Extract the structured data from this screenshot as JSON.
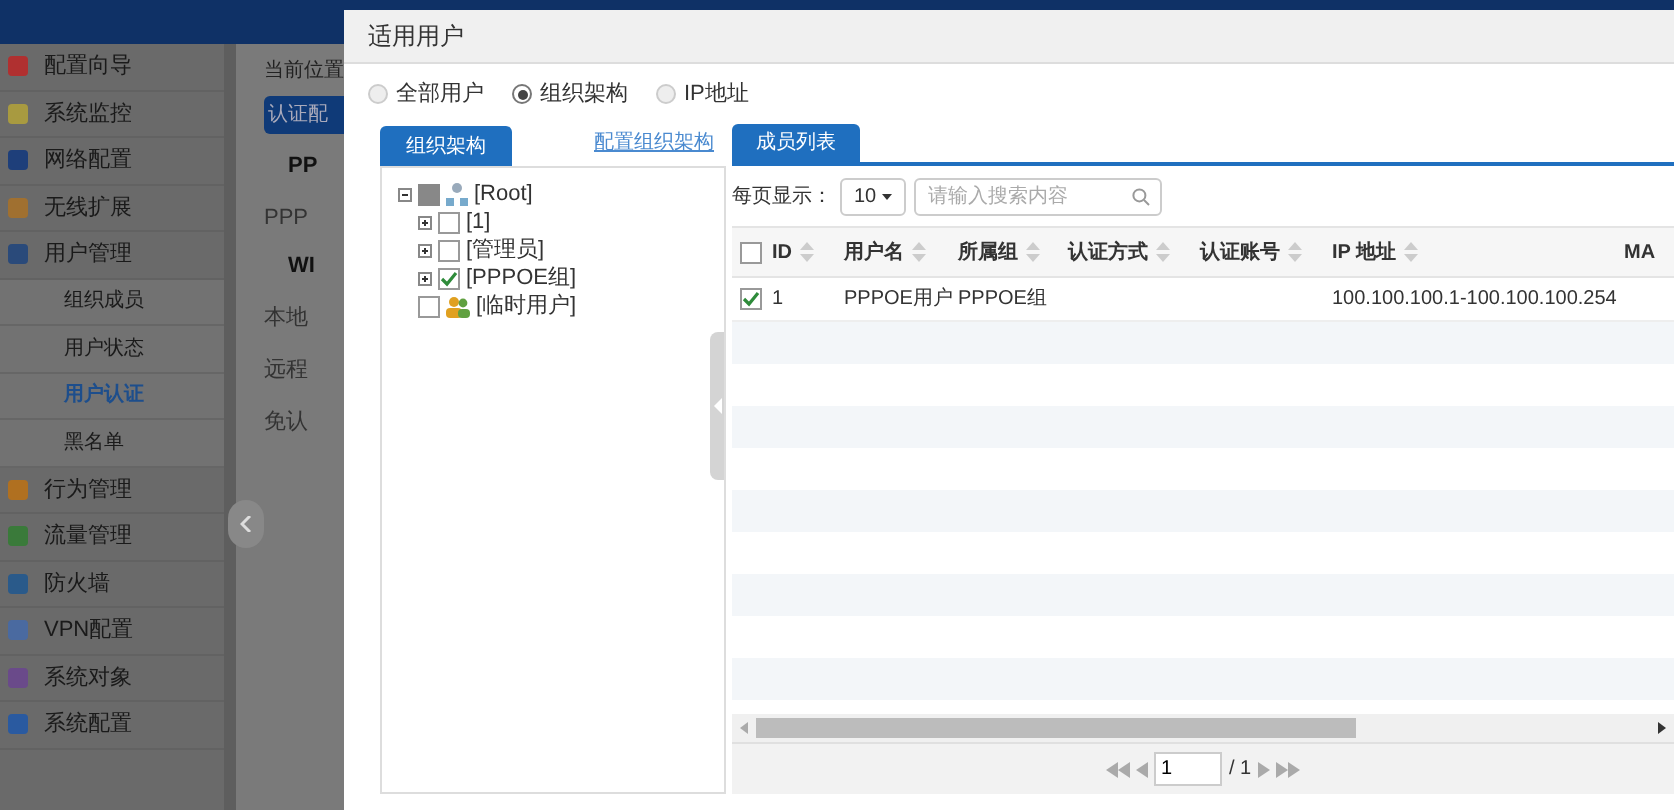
{
  "sidebar": {
    "items": [
      {
        "label": "配置向导",
        "kind": "item",
        "color": "#b03030",
        "selected": false
      },
      {
        "label": "系统监控",
        "kind": "item",
        "color": "#a89a40",
        "selected": false
      },
      {
        "label": "网络配置",
        "kind": "item",
        "color": "#1e3f7a",
        "selected": false
      },
      {
        "label": "无线扩展",
        "kind": "item",
        "color": "#a07030",
        "selected": false
      },
      {
        "label": "用户管理",
        "kind": "item",
        "color": "#2a4a7a",
        "selected": false
      },
      {
        "label": "组织成员",
        "kind": "subitem",
        "selected": false
      },
      {
        "label": "用户状态",
        "kind": "subitem",
        "selected": false
      },
      {
        "label": "用户认证",
        "kind": "subitem",
        "selected": true
      },
      {
        "label": "黑名单",
        "kind": "subitem",
        "selected": false
      },
      {
        "label": "行为管理",
        "kind": "item",
        "color": "#b07020",
        "selected": false
      },
      {
        "label": "流量管理",
        "kind": "item",
        "color": "#3a7a3a",
        "selected": false
      },
      {
        "label": "防火墙",
        "kind": "item",
        "color": "#2a5a8a",
        "selected": false
      },
      {
        "label": "VPN配置",
        "kind": "item",
        "color": "#4a6aa0",
        "selected": false
      },
      {
        "label": "系统对象",
        "kind": "item",
        "color": "#6a4a8a",
        "selected": false
      },
      {
        "label": "系统配置",
        "kind": "item",
        "color": "#2a5aa0",
        "selected": false
      }
    ]
  },
  "background": {
    "breadcrumb": "当前位置",
    "button": "认证配",
    "lines": [
      {
        "text": "PP",
        "kind": "heading"
      },
      {
        "text": "PPP",
        "kind": "text"
      },
      {
        "text": "WI",
        "kind": "heading"
      },
      {
        "text": "本地",
        "kind": "text"
      },
      {
        "text": "远程",
        "kind": "text"
      },
      {
        "text": "免认",
        "kind": "text"
      }
    ]
  },
  "dialog": {
    "title": "适用用户",
    "scope_options": [
      {
        "label": "全部用户",
        "selected": false
      },
      {
        "label": "组织架构",
        "selected": true
      },
      {
        "label": "IP地址",
        "selected": false
      }
    ],
    "left_tab": "组织架构",
    "config_link": "配置组织架构",
    "tree": [
      {
        "label": "[Root]",
        "checked": false,
        "partial": true,
        "expanded": true,
        "kind": "root",
        "children": [
          {
            "label": "[1]",
            "checked": false,
            "partial": false,
            "expanded": false
          },
          {
            "label": "[管理员]",
            "checked": false,
            "partial": false,
            "expanded": false
          },
          {
            "label": "[PPPOE组]",
            "checked": true,
            "partial": false,
            "expanded": false
          }
        ]
      },
      {
        "label": "[临时用户]",
        "checked": false,
        "partial": false,
        "kind": "temporary"
      }
    ],
    "right_tab": "成员列表",
    "page_size_label": "每页显示：",
    "page_size": "10",
    "search": {
      "placeholder": "请输入搜索内容"
    },
    "table": {
      "all_checked": false,
      "columns": [
        "ID",
        "用户名",
        "所属组",
        "认证方式",
        "认证账号",
        "IP 地址",
        "MA"
      ],
      "rows": [
        {
          "checked": true,
          "cells": [
            "1",
            "PPPOE用户",
            "PPPOE组",
            "",
            "",
            "100.100.100.1-100.100.100.254",
            ""
          ]
        }
      ]
    },
    "pager": {
      "page": "1",
      "total": "/ 1"
    }
  }
}
